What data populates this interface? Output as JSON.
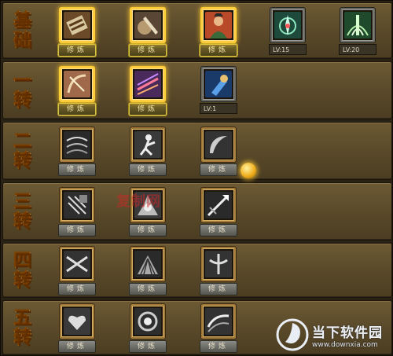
{
  "tiers": [
    {
      "label": "基础",
      "chars": [
        "基",
        "础"
      ]
    },
    {
      "label": "一转",
      "chars": [
        "一",
        "转"
      ]
    },
    {
      "label": "二转",
      "chars": [
        "二",
        "转"
      ]
    },
    {
      "label": "三转",
      "chars": [
        "三",
        "转"
      ]
    },
    {
      "label": "四转",
      "chars": [
        "四",
        "转"
      ]
    },
    {
      "label": "五转",
      "chars": [
        "五",
        "转"
      ]
    }
  ],
  "train_label": "修炼",
  "level_labels": {
    "basic_skill_4": "LV:15",
    "basic_skill_5": "LV:20",
    "first_skill_3": "LV:1"
  },
  "watermark": "复制网",
  "brand": {
    "name": "当下软件园",
    "url": "www.downxia.com"
  },
  "colors": {
    "tier_text": "#ffd86a",
    "row_bg": "#5a4a2a",
    "glow": "#ffcc33",
    "accent_coin": "#f0b020"
  }
}
